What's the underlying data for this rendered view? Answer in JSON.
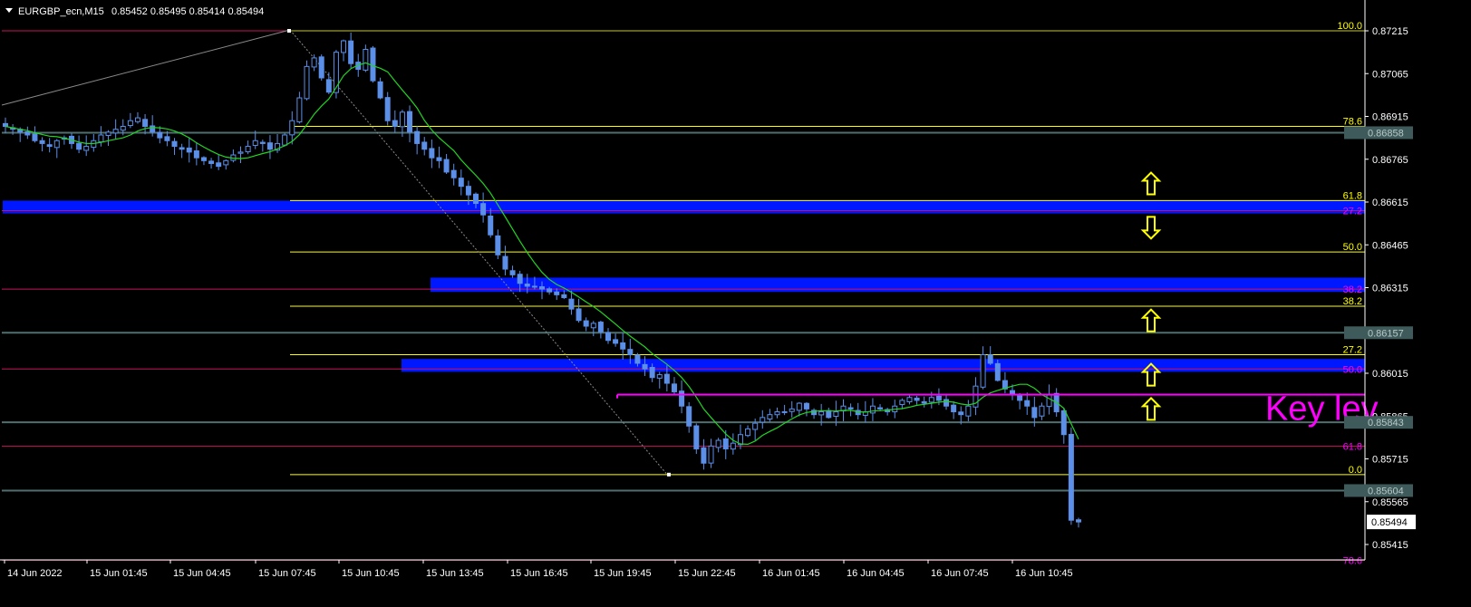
{
  "header": {
    "symbol": "EURGBP_ecn,M15",
    "ohlc": "0.85452 0.85495 0.85414 0.85494",
    "menu_icon": "triangle-down-icon"
  },
  "colors": {
    "background": "#000000",
    "axis": "#ffffff",
    "fib_yellow": "#ffff00",
    "fib_magenta": "#ff00ff",
    "fib_crimson": "#c8145a",
    "level_gray": "#4f6f6f",
    "zone_blue": "#0018ff",
    "candle": "#5b8fe8",
    "ma_green": "#22d422",
    "key_level": "#ff00ff",
    "arrow_yellow": "#ffff00"
  },
  "price_axis": {
    "ticks": [
      "0.87215",
      "0.87065",
      "0.86915",
      "0.86765",
      "0.86615",
      "0.86465",
      "0.86315",
      "0.86157",
      "0.86015",
      "0.85865",
      "0.85715",
      "0.85565",
      "0.85415"
    ],
    "current_price": "0.85494",
    "level_tags": [
      {
        "price": 0.86858,
        "text": "0.86858"
      },
      {
        "price": 0.86157,
        "text": "0.86157"
      },
      {
        "price": 0.85843,
        "text": "0.85843"
      },
      {
        "price": 0.85604,
        "text": "0.85604"
      }
    ]
  },
  "time_axis": {
    "labels": [
      "14 Jun 2022",
      "15 Jun 01:45",
      "15 Jun 04:45",
      "15 Jun 07:45",
      "15 Jun 10:45",
      "15 Jun 13:45",
      "15 Jun 16:45",
      "15 Jun 19:45",
      "15 Jun 22:45",
      "16 Jun 01:45",
      "16 Jun 04:45",
      "16 Jun 07:45",
      "16 Jun 10:45"
    ]
  },
  "fib_labels": {
    "yellow": [
      {
        "price": 0.87215,
        "text": "100.0"
      },
      {
        "price": 0.8688,
        "text": "78.6"
      },
      {
        "price": 0.8662,
        "text": "61.8"
      },
      {
        "price": 0.8644,
        "text": "50.0"
      },
      {
        "price": 0.8625,
        "text": "38.2"
      },
      {
        "price": 0.8608,
        "text": "27.2"
      },
      {
        "price": 0.8566,
        "text": "0.0"
      }
    ],
    "magenta": [
      {
        "price": 0.86585,
        "text": "27.2"
      },
      {
        "price": 0.8631,
        "text": "38.2"
      },
      {
        "price": 0.8603,
        "text": "50.0"
      },
      {
        "price": 0.8576,
        "text": "61.8"
      },
      {
        "price": 0.8536,
        "text": "78.6"
      }
    ]
  },
  "annotations": {
    "key_level_text": "Key lev",
    "key_level_price": 0.8594
  },
  "arrows": [
    {
      "dir": "up",
      "price": 0.8668
    },
    {
      "dir": "down",
      "price": 0.86525
    },
    {
      "dir": "up",
      "price": 0.862
    },
    {
      "dir": "up",
      "price": 0.8601
    },
    {
      "dir": "up",
      "price": 0.8589
    }
  ],
  "chart_data": {
    "type": "candlestick",
    "symbol": "EURGBP_ecn",
    "timeframe": "M15",
    "ylim": [
      0.8538,
      0.8726
    ],
    "levels": [
      0.86858,
      0.86157,
      0.85843,
      0.85604
    ],
    "blue_zones": [
      [
        0.86575,
        0.8662
      ],
      [
        0.863,
        0.8635
      ],
      [
        0.8602,
        0.86065
      ]
    ],
    "key_level": 0.8594,
    "fib_yellow_levels": [
      0.87215,
      0.8688,
      0.8662,
      0.8644,
      0.8625,
      0.8608,
      0.8566
    ],
    "fib_magenta_levels": [
      0.86585,
      0.8631,
      0.8603,
      0.8576,
      0.8536
    ],
    "close_path": [
      0.8688,
      0.8687,
      0.8686,
      0.8685,
      0.8683,
      0.8682,
      0.8681,
      0.8683,
      0.8684,
      0.8682,
      0.868,
      0.8681,
      0.8683,
      0.8685,
      0.8686,
      0.8687,
      0.8688,
      0.869,
      0.8691,
      0.8688,
      0.8686,
      0.8684,
      0.8683,
      0.8681,
      0.868,
      0.8679,
      0.8677,
      0.8676,
      0.8675,
      0.8674,
      0.8676,
      0.8678,
      0.8679,
      0.8681,
      0.8683,
      0.8682,
      0.868,
      0.8682,
      0.8685,
      0.869,
      0.8698,
      0.8709,
      0.8712,
      0.8705,
      0.87,
      0.8714,
      0.8718,
      0.871,
      0.8708,
      0.8715,
      0.8704,
      0.8698,
      0.869,
      0.8688,
      0.8693,
      0.8686,
      0.8682,
      0.868,
      0.8677,
      0.8676,
      0.8672,
      0.867,
      0.8667,
      0.8664,
      0.8661,
      0.8657,
      0.865,
      0.8643,
      0.8638,
      0.8636,
      0.8633,
      0.8632,
      0.8632,
      0.8631,
      0.863,
      0.8629,
      0.8628,
      0.8624,
      0.862,
      0.8618,
      0.8619,
      0.8616,
      0.8613,
      0.8612,
      0.861,
      0.8608,
      0.8605,
      0.8603,
      0.86,
      0.8601,
      0.8598,
      0.8595,
      0.859,
      0.8583,
      0.8575,
      0.857,
      0.8576,
      0.8578,
      0.8575,
      0.8577,
      0.858,
      0.8582,
      0.8584,
      0.8586,
      0.8587,
      0.8588,
      0.8588,
      0.8589,
      0.8591,
      0.8589,
      0.8587,
      0.8588,
      0.8586,
      0.8588,
      0.859,
      0.8589,
      0.8587,
      0.8588,
      0.859,
      0.8589,
      0.8588,
      0.859,
      0.8592,
      0.8593,
      0.8592,
      0.8591,
      0.8593,
      0.8592,
      0.859,
      0.8588,
      0.8587,
      0.859,
      0.8597,
      0.8608,
      0.8605,
      0.8599,
      0.8596,
      0.8594,
      0.8592,
      0.859,
      0.8586,
      0.859,
      0.8594,
      0.8588,
      0.858,
      0.855,
      0.85494
    ]
  }
}
